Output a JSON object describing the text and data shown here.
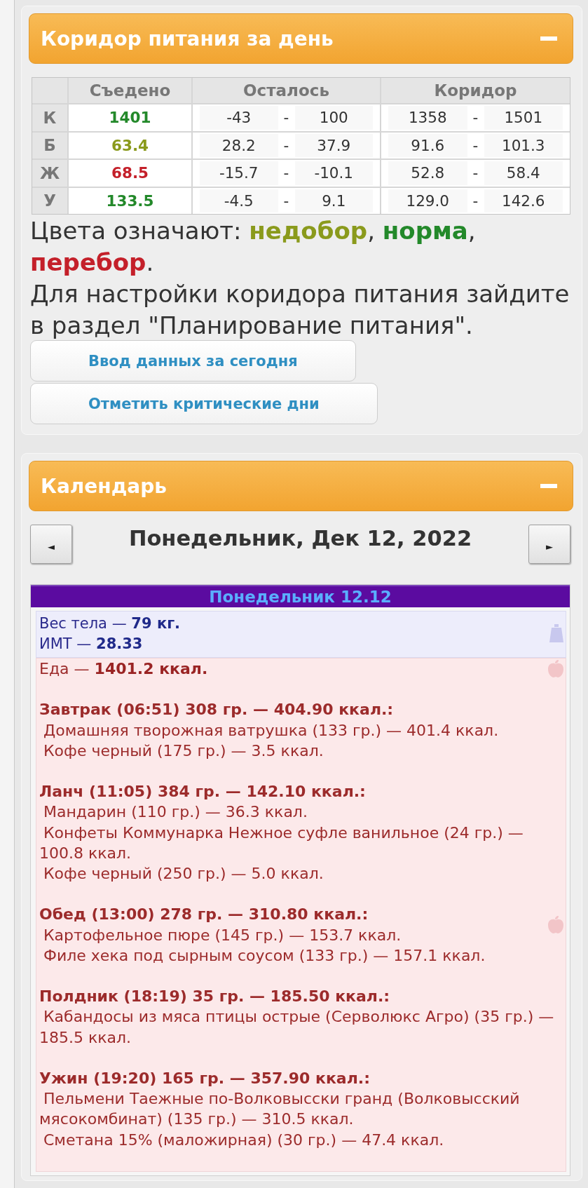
{
  "nutrition_panel": {
    "title": "Коридор питания за день",
    "table": {
      "columns": [
        "Съедено",
        "Осталось",
        "Коридор"
      ],
      "rows": [
        {
          "label": "К",
          "eaten": {
            "value": "1401",
            "color": "#23892a"
          },
          "left": {
            "from": "-43",
            "separator": "-",
            "to": "100"
          },
          "corridor": {
            "from": "1358",
            "separator": "-",
            "to": "1501"
          }
        },
        {
          "label": "Б",
          "eaten": {
            "value": "63.4",
            "color": "#8a9a1c"
          },
          "left": {
            "from": "28.2",
            "separator": "-",
            "to": "37.9"
          },
          "corridor": {
            "from": "91.6",
            "separator": "-",
            "to": "101.3"
          }
        },
        {
          "label": "Ж",
          "eaten": {
            "value": "68.5",
            "color": "#c4202a"
          },
          "left": {
            "from": "-15.7",
            "separator": "-",
            "to": "-10.1"
          },
          "corridor": {
            "from": "52.8",
            "separator": "-",
            "to": "58.4"
          }
        },
        {
          "label": "У",
          "eaten": {
            "value": "133.5",
            "color": "#23892a"
          },
          "left": {
            "from": "-4.5",
            "separator": "-",
            "to": "9.1"
          },
          "corridor": {
            "from": "129.0",
            "separator": "-",
            "to": "142.6"
          }
        }
      ]
    },
    "legend": {
      "prefix": "Цвета означают:",
      "items": [
        {
          "label": "недобор",
          "color": "#8a9a1c",
          "after": ","
        },
        {
          "label": "норма",
          "color": "#23892a",
          "after": ","
        },
        {
          "label": "перебор",
          "color": "#c4202a",
          "after": "."
        }
      ]
    },
    "note": "Для настройки коридора питания зайдите в раздел \"Планирование питания\".",
    "buttons": [
      "Ввод данных за сегодня",
      "Отметить критические дни"
    ]
  },
  "calendar_panel": {
    "title": "Календарь",
    "prev_button": "◄",
    "date": "Понедельник, Дек 12, 2022",
    "next_button": "►",
    "day": {
      "header": "Понедельник 12.12",
      "body_stats": [
        "Вес тела — **79 кг.**",
        "ИМТ — **28.33**"
      ],
      "food_total": "Еда — **1401.2 ккал.**",
      "meals": [
        {
          "title": "Завтрак (06:51) 308 гр. — 404.90 ккал.:",
          "items": [
            "Домашняя творожная ватрушка (133 гр.) — 401.4 ккал.",
            "Кофе черный (175 гр.) — 3.5 ккал."
          ]
        },
        {
          "title": "Ланч (11:05) 384 гр. — 142.10 ккал.:",
          "items": [
            "Мандарин (110 гр.) — 36.3 ккал.",
            "Конфеты Коммунарка Нежное суфле ванильное (24 гр.) — 100.8 ккал.",
            "Кофе черный (250 гр.) — 5.0 ккал."
          ]
        },
        {
          "title": "Обед (13:00) 278 гр. — 310.80 ккал.:",
          "items": [
            "Картофельное пюре (145 гр.) — 153.7 ккал.",
            "Филе хека под сырным соусом (133 гр.) — 157.1 ккал."
          ]
        },
        {
          "title": "Полдник (18:19) 35 гр. — 185.50 ккал.:",
          "items": [
            "Кабандосы из мяса птицы острые (Серволюкс Агро) (35 гр.) — 185.5 ккал."
          ]
        },
        {
          "title": "Ужин (19:20) 165 гр. — 357.90 ккал.:",
          "items": [
            "Пельмени Таежные по-Волковысски гранд (Волковысский мясокомбинат) (135 гр.) — 310.5 ккал.",
            "Сметана 15% (маложирная) (30 гр.) — 47.4 ккал."
          ]
        }
      ]
    }
  }
}
